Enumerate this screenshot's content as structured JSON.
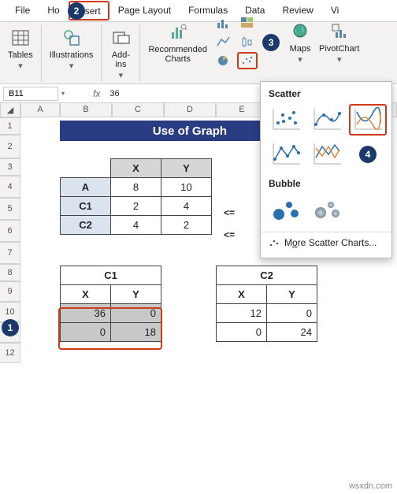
{
  "tabs": {
    "file": "File",
    "home": "Ho",
    "insert": "Insert",
    "pagelayout": "Page Layout",
    "formulas": "Formulas",
    "data": "Data",
    "review": "Review",
    "vi": "Vi"
  },
  "ribbon": {
    "tables": "Tables",
    "illustrations": "Illustrations",
    "addins": "Add-\nins",
    "recommended": "Recommended\nCharts",
    "maps": "Maps",
    "pivotchart": "PivotChart"
  },
  "formula_bar": {
    "namebox": "B11",
    "fx_label": "fx",
    "value": "36"
  },
  "col_headers": [
    "A",
    "B",
    "C",
    "D",
    "E"
  ],
  "row_headers": [
    "1",
    "2",
    "3",
    "4",
    "5",
    "6",
    "7",
    "8",
    "9",
    "10",
    "11",
    "12"
  ],
  "title": "Use of Graph",
  "table_xy": {
    "x": "X",
    "y": "Y",
    "rows": [
      {
        "label": "A",
        "x": "8",
        "y": "10"
      },
      {
        "label": "C1",
        "x": "2",
        "y": "4"
      },
      {
        "label": "C2",
        "x": "4",
        "y": "2"
      }
    ],
    "notes": [
      "<=",
      "<="
    ]
  },
  "c1": {
    "title": "C1",
    "x": "X",
    "y": "Y",
    "rows": [
      [
        "36",
        "0"
      ],
      [
        "0",
        "18"
      ]
    ]
  },
  "c2": {
    "title": "C2",
    "x": "X",
    "y": "Y",
    "rows": [
      [
        "12",
        "0"
      ],
      [
        "0",
        "24"
      ]
    ]
  },
  "dropdown": {
    "scatter": "Scatter",
    "bubble": "Bubble",
    "more_pre": "M",
    "more_u": "o",
    "more_post": "re Scatter Charts..."
  },
  "steps": {
    "s1": "1",
    "s2": "2",
    "s3": "3",
    "s4": "4"
  },
  "watermark": "wsxdn.com"
}
